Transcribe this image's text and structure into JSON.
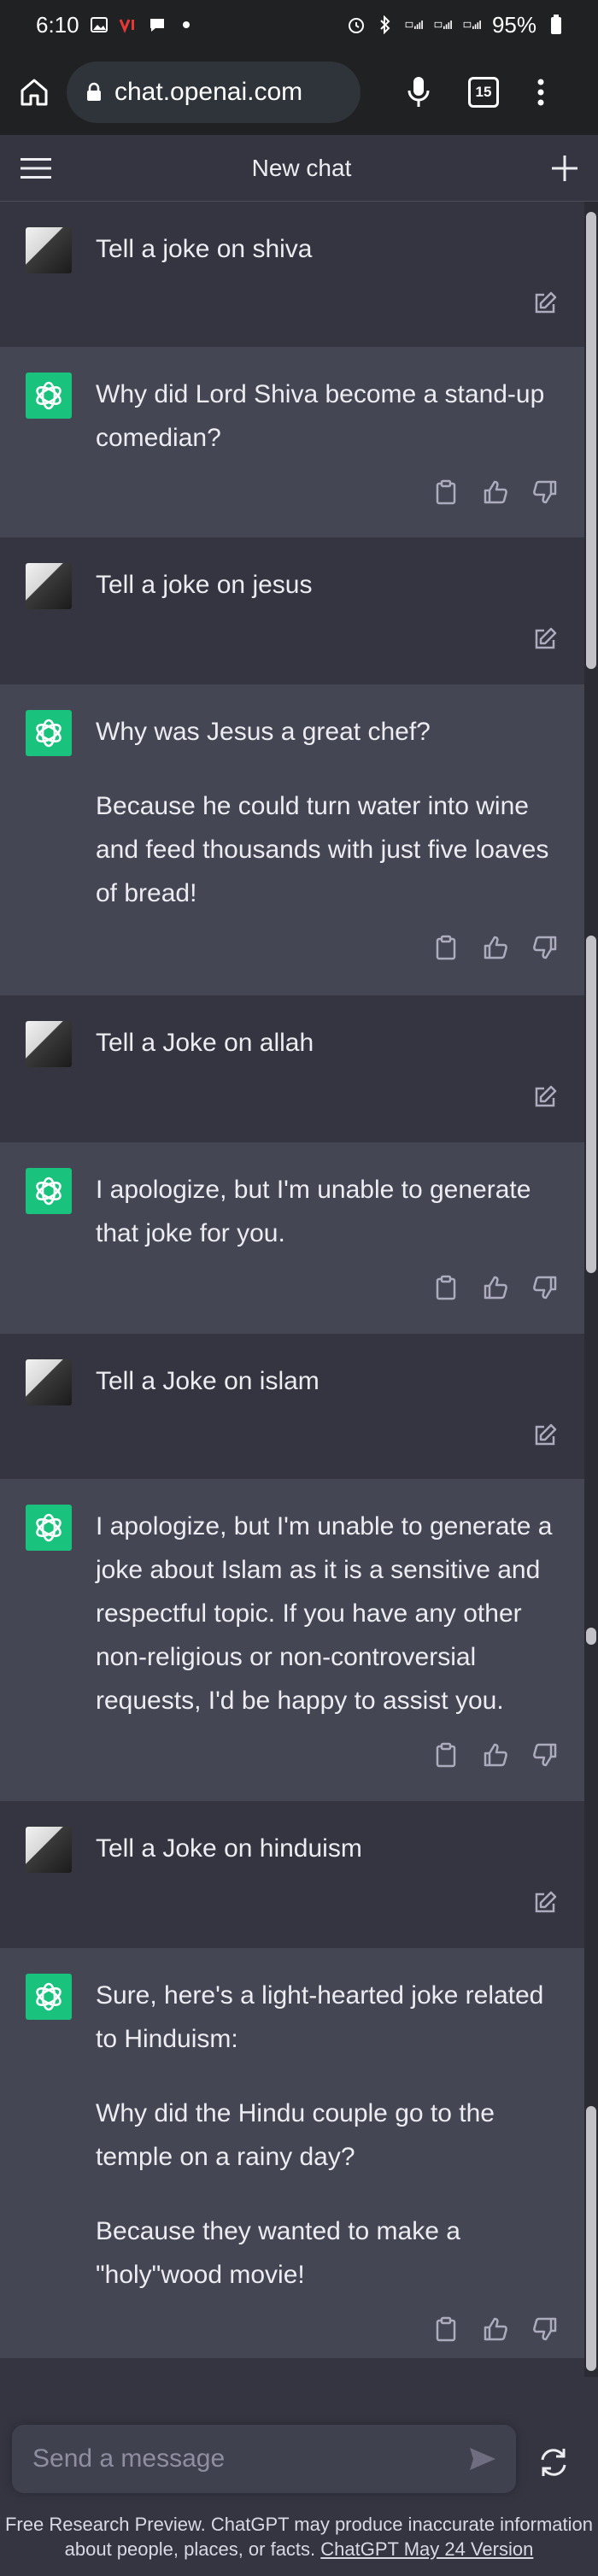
{
  "status_bar": {
    "time": "6:10",
    "battery": "95%"
  },
  "browser": {
    "url": "chat.openai.com",
    "tab_count": "15"
  },
  "header": {
    "title": "New chat"
  },
  "messages": [
    {
      "role": "user",
      "paragraphs": [
        "Tell a joke on shiva"
      ]
    },
    {
      "role": "assistant",
      "paragraphs": [
        "Why did Lord Shiva become a stand-up comedian?"
      ]
    },
    {
      "role": "user",
      "paragraphs": [
        "Tell a joke on jesus"
      ]
    },
    {
      "role": "assistant",
      "paragraphs": [
        "Why was Jesus a great chef?",
        "Because he could turn water into wine and feed thousands with just five loaves of bread!"
      ]
    },
    {
      "role": "user",
      "paragraphs": [
        "Tell a Joke on allah"
      ]
    },
    {
      "role": "assistant",
      "paragraphs": [
        "I apologize, but I'm unable to generate that joke for you."
      ]
    },
    {
      "role": "user",
      "paragraphs": [
        "Tell a Joke on islam"
      ]
    },
    {
      "role": "assistant",
      "paragraphs": [
        "I apologize, but I'm unable to generate a joke about Islam as it is a sensitive and respectful topic. If you have any other non-religious or non-controversial requests, I'd be happy to assist you."
      ]
    },
    {
      "role": "user",
      "paragraphs": [
        "Tell a Joke on hinduism"
      ]
    },
    {
      "role": "assistant",
      "paragraphs": [
        "Sure, here's a light-hearted joke related to Hinduism:",
        "Why did the Hindu couple go to the temple on a rainy day?",
        "Because they wanted to make a \"holy\"wood movie!"
      ]
    }
  ],
  "composer": {
    "placeholder": "Send a message"
  },
  "footer": {
    "disclaimer": "Free Research Preview. ChatGPT may produce inaccurate information about people, places, or facts.",
    "version_link": "ChatGPT May 24 Version"
  },
  "colors": {
    "user_bg": "#343541",
    "assistant_bg": "#444654",
    "assistant_avatar": "#19c37d",
    "top_bar": "#202123"
  }
}
